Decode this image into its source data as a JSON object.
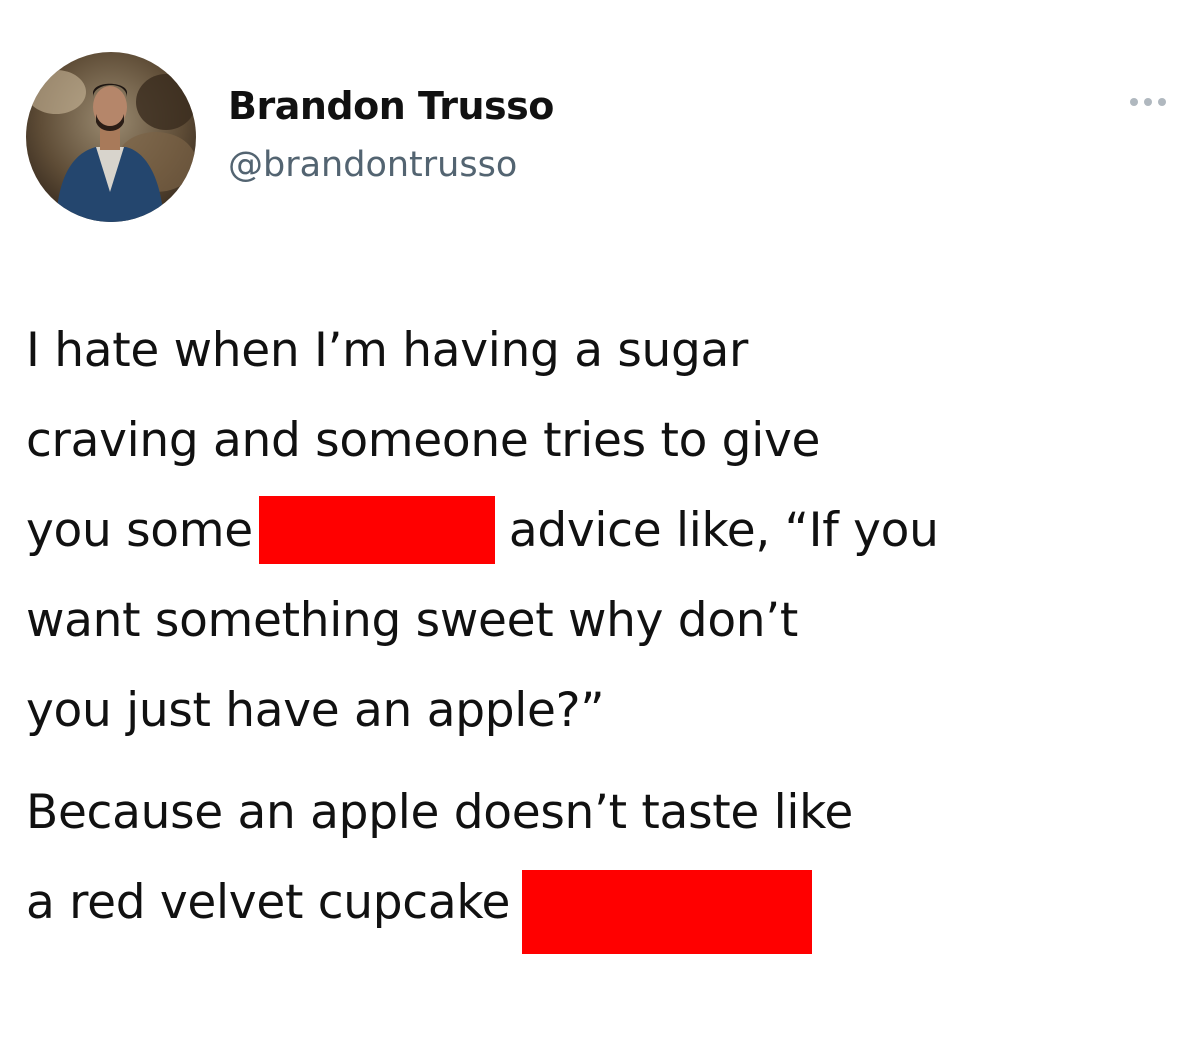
{
  "tweet": {
    "author": {
      "display_name": "Brandon Trusso",
      "handle": "@brandontrusso"
    },
    "menu_icon": "more-horizontal-icon",
    "redaction_color": "#ff0000",
    "paragraph1": {
      "line1": "I hate when I’m having a sugar",
      "line2": "craving and someone tries to give",
      "line3_before": "you some",
      "line3_after": "advice like, “If you",
      "line4": "want something sweet why don’t",
      "line5": "you just have an apple?”"
    },
    "paragraph2": {
      "line1": "Because an apple doesn’t taste like",
      "line2": "a red velvet cupcake"
    }
  }
}
